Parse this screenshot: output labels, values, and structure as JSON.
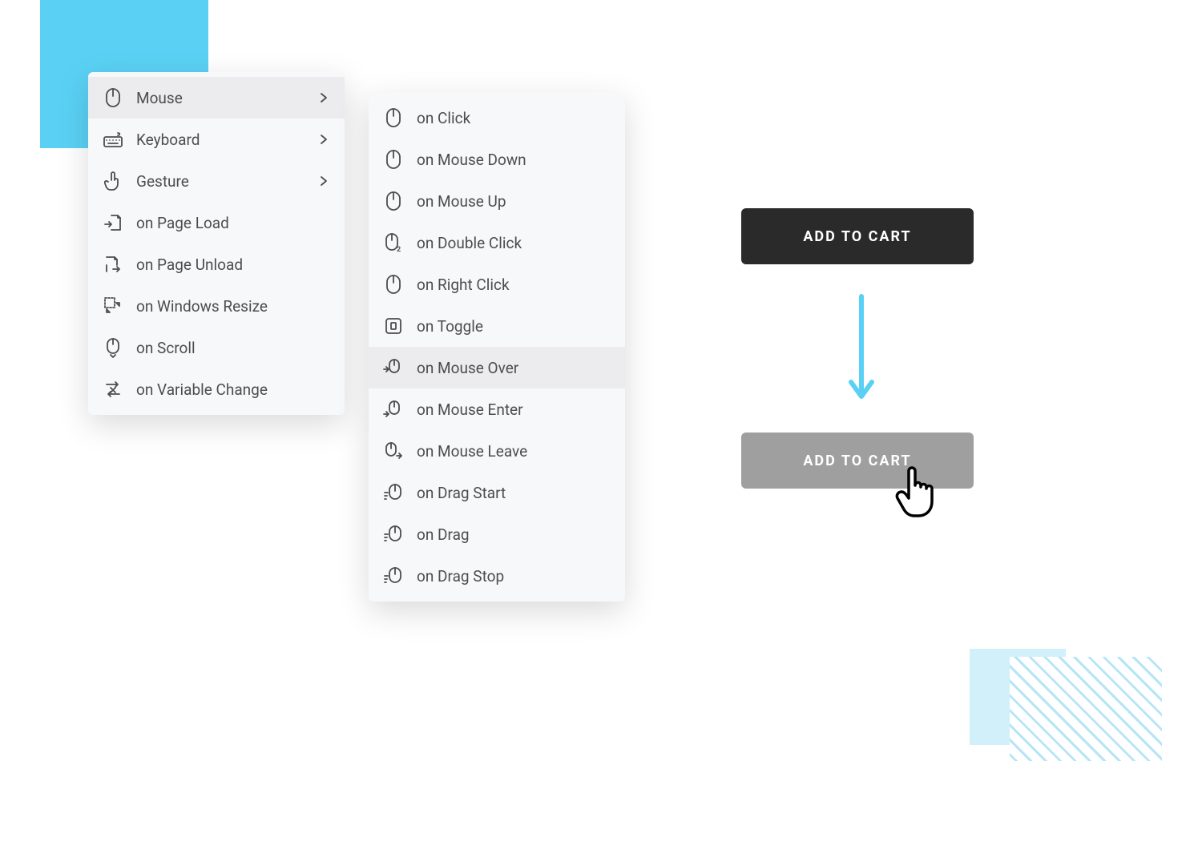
{
  "menu1": {
    "items": [
      {
        "icon": "mouse-icon",
        "label": "Mouse",
        "chevron": true,
        "hover": true
      },
      {
        "icon": "keyboard-icon",
        "label": "Keyboard",
        "chevron": true
      },
      {
        "icon": "gesture-icon",
        "label": "Gesture",
        "chevron": true
      },
      {
        "icon": "page-load-icon",
        "label": "on Page Load"
      },
      {
        "icon": "page-unload-icon",
        "label": "on Page Unload"
      },
      {
        "icon": "resize-icon",
        "label": "on Windows Resize"
      },
      {
        "icon": "scroll-icon",
        "label": "on Scroll"
      },
      {
        "icon": "variable-change-icon",
        "label": "on Variable Change"
      }
    ]
  },
  "menu2": {
    "items": [
      {
        "icon": "mouse-icon",
        "label": "on Click"
      },
      {
        "icon": "mouse-icon",
        "label": "on Mouse Down"
      },
      {
        "icon": "mouse-icon",
        "label": "on Mouse Up"
      },
      {
        "icon": "double-click-icon",
        "label": "on Double Click"
      },
      {
        "icon": "mouse-icon",
        "label": "on Right Click"
      },
      {
        "icon": "toggle-icon",
        "label": "on Toggle"
      },
      {
        "icon": "mouse-over-icon",
        "label": "on Mouse Over",
        "hover": true
      },
      {
        "icon": "mouse-enter-icon",
        "label": "on Mouse Enter"
      },
      {
        "icon": "mouse-leave-icon",
        "label": "on Mouse Leave"
      },
      {
        "icon": "drag-start-icon",
        "label": "on Drag Start"
      },
      {
        "icon": "drag-icon",
        "label": "on Drag"
      },
      {
        "icon": "drag-stop-icon",
        "label": "on Drag Stop"
      }
    ]
  },
  "buttons": {
    "dark": "ADD TO CART",
    "gray": "ADD TO CART"
  },
  "colors": {
    "accent": "#5ad1f4",
    "dark": "#2a2a2a",
    "gray": "#9f9f9f"
  }
}
